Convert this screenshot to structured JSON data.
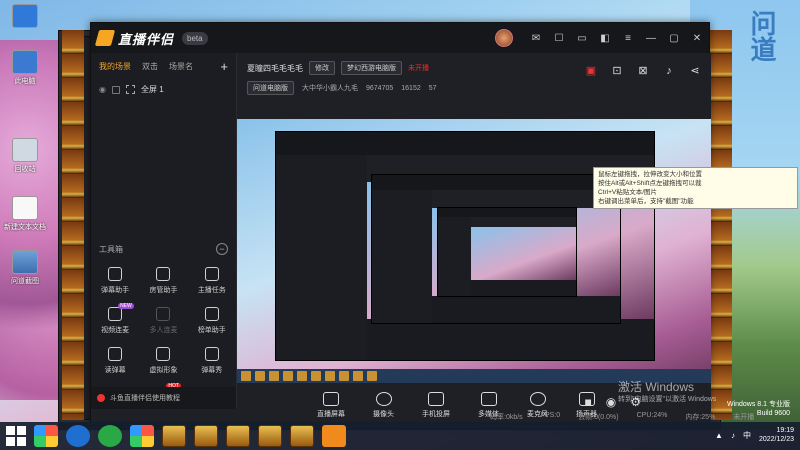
{
  "desktop": {
    "icons": [
      {
        "label": "",
        "kind": "blue"
      },
      {
        "label": "此电脑",
        "kind": "pc"
      },
      {
        "label": "回收站",
        "kind": "bin"
      },
      {
        "label": "新建文本文档",
        "kind": "doc"
      },
      {
        "label": "问道截图",
        "kind": "img"
      }
    ],
    "calligraphy": "问道"
  },
  "app": {
    "logo": "直播伴侣",
    "version": "beta",
    "title_icons": [
      "mail-icon",
      "chat-icon",
      "screen-icon",
      "skin-icon",
      "menu-icon",
      "minimize-icon",
      "maximize-icon",
      "close-icon"
    ],
    "left_tabs": [
      "我的场景",
      "双击",
      "场景名"
    ],
    "scene_item": "全屏 1",
    "tools_title": "工具箱",
    "tools": [
      {
        "label": "弹幕助手",
        "dim": false,
        "badge": ""
      },
      {
        "label": "房管助手",
        "dim": false,
        "badge": ""
      },
      {
        "label": "主播任务",
        "dim": false,
        "badge": ""
      },
      {
        "label": "视频连麦",
        "dim": false,
        "badge": "NEW"
      },
      {
        "label": "多人连麦",
        "dim": true,
        "badge": ""
      },
      {
        "label": "榜单助手",
        "dim": false,
        "badge": ""
      },
      {
        "label": "读弹幕",
        "dim": false,
        "badge": ""
      },
      {
        "label": "虚拟形象",
        "dim": false,
        "badge": ""
      },
      {
        "label": "弹幕秀",
        "dim": false,
        "badge": ""
      },
      {
        "label": "",
        "dim": false,
        "badge": ""
      },
      {
        "label": "",
        "dim": false,
        "badge": "HOT"
      },
      {
        "label": "",
        "dim": false,
        "badge": ""
      }
    ],
    "footer_notice": "斗鱼直播伴侣使用教程",
    "room": {
      "name": "夏瞳四毛毛毛毛",
      "edit_label": "修改",
      "category": "梦幻西游电脑版",
      "alert": "未开播",
      "tag": "问道电脑版",
      "region": "大中华小霸人九毛",
      "room_id": "9674705",
      "followers": "16152",
      "fans": "57"
    },
    "controls": [
      {
        "label": "直播屏幕"
      },
      {
        "label": "摄像头"
      },
      {
        "label": "手机投屏"
      },
      {
        "label": "多媒体"
      },
      {
        "label": "麦克风"
      },
      {
        "label": "扬声器"
      }
    ],
    "stats": [
      "码率:0kb/s",
      "FPS:0",
      "丢帧:0(0.0%)",
      "CPU:24%",
      "内存:25%",
      "未开播"
    ]
  },
  "tooltip": {
    "lines": [
      "鼠标左键拖拽，拉伸改变大小和位置",
      "按住Alt或Alt+Shift点左键拖拽可以裁",
      "Ctrl+V粘贴文本/图片",
      "右键调出菜单后，支持\"截图\"功能"
    ]
  },
  "watermark": {
    "title": "激活 Windows",
    "subtitle": "转到\"电脑设置\"以激活 Windows",
    "version": "Windows 8.1 专业版",
    "build": "Build 9600"
  },
  "taskbar": {
    "time": "19:19",
    "date": "2022/12/23"
  }
}
